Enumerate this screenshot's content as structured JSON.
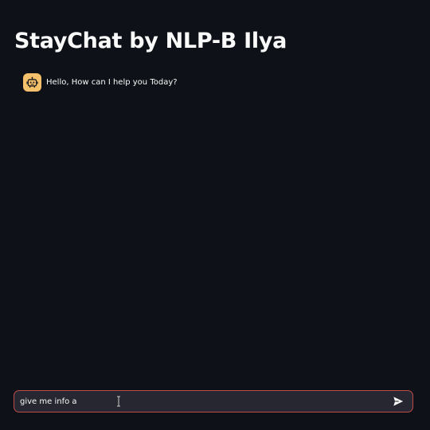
{
  "header": {
    "title": "StayChat by NLP-B Ilya"
  },
  "messages": [
    {
      "role": "assistant",
      "avatar_icon": "robot-icon",
      "text": "Hello, How can I help you Today?"
    }
  ],
  "input": {
    "value": "give me info a",
    "send_icon": "send-icon"
  },
  "colors": {
    "background": "#0e1117",
    "avatar": "#f5c26b",
    "input_background": "#262730",
    "input_border": "#c04b4b",
    "text": "#fafafa"
  }
}
